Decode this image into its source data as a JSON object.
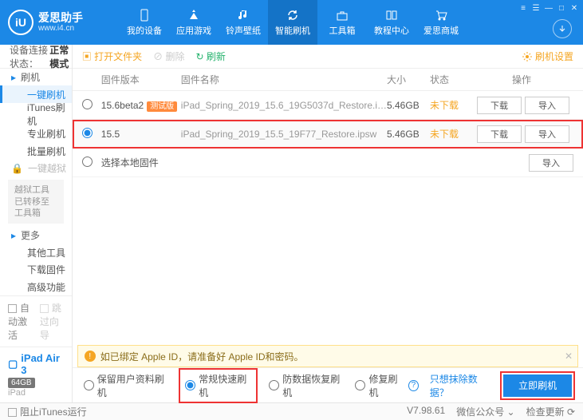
{
  "header": {
    "app_name": "爱思助手",
    "url": "www.i4.cn",
    "nav": [
      "我的设备",
      "应用游戏",
      "铃声壁纸",
      "智能刷机",
      "工具箱",
      "教程中心",
      "爱思商城"
    ]
  },
  "sidebar": {
    "status_label": "设备连接状态：",
    "status_value": "正常模式",
    "g1": "刷机",
    "g1_items": [
      "一键刷机",
      "iTunes刷机",
      "专业刷机",
      "批量刷机"
    ],
    "g2": "一键越狱",
    "g2_note": "越狱工具已转移至工具箱",
    "g3": "更多",
    "g3_items": [
      "其他工具",
      "下载固件",
      "高级功能"
    ],
    "auto_activate": "自动激活",
    "skip_guide": "跳过向导",
    "device_name": "iPad Air 3",
    "device_cap": "64GB",
    "device_model": "iPad"
  },
  "toolbar": {
    "open": "打开文件夹",
    "delete": "删除",
    "refresh": "刷新",
    "settings": "刷机设置"
  },
  "table": {
    "h_ver": "固件版本",
    "h_name": "固件名称",
    "h_size": "大小",
    "h_stat": "状态",
    "h_ops": "操作",
    "rows": [
      {
        "ver": "15.6beta2",
        "badge": "测试版",
        "name": "iPad_Spring_2019_15.6_19G5037d_Restore.i…",
        "size": "5.46GB",
        "stat": "未下载"
      },
      {
        "ver": "15.5",
        "badge": "",
        "name": "iPad_Spring_2019_15.5_19F77_Restore.ipsw",
        "size": "5.46GB",
        "stat": "未下载"
      }
    ],
    "btn_dl": "下载",
    "btn_imp": "导入",
    "local": "选择本地固件"
  },
  "warning": "如已绑定 Apple ID，请准备好 Apple ID和密码。",
  "options": {
    "o1": "保留用户资料刷机",
    "o2": "常规快速刷机",
    "o3": "防数据恢复刷机",
    "o4": "修复刷机",
    "link": "只想抹除数据？",
    "go": "立即刷机"
  },
  "status": {
    "block": "阻止iTunes运行",
    "ver": "V7.98.61",
    "wx": "微信公众号",
    "upd": "检查更新"
  }
}
